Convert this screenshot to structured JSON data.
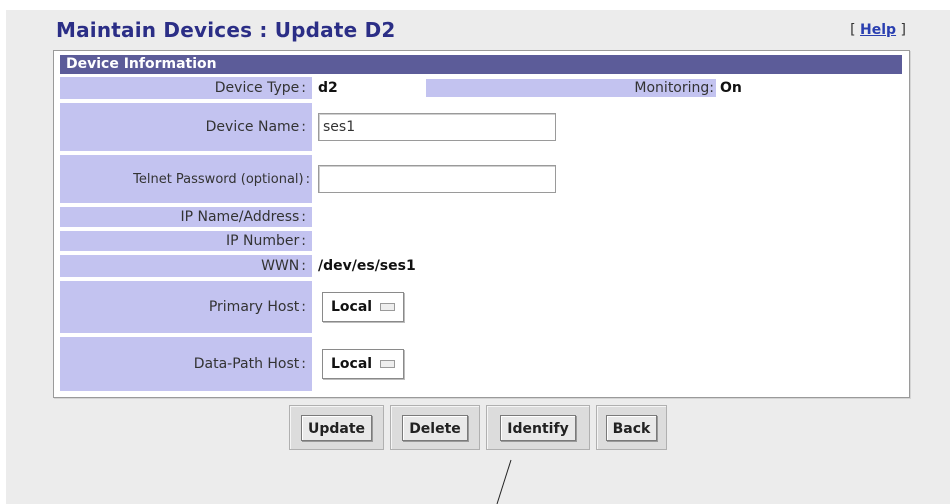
{
  "page": {
    "title": "Maintain Devices : Update D2",
    "help_open": "[ ",
    "help_label": "Help",
    "help_close": " ]"
  },
  "section": {
    "title": "Device Information"
  },
  "fields": {
    "device_type": {
      "label": "Device Type",
      "value": "d2"
    },
    "monitoring": {
      "label": "Monitoring:",
      "value": "On"
    },
    "device_name": {
      "label": "Device Name",
      "value": "ses1",
      "placeholder": ""
    },
    "telnet_password": {
      "label": "Telnet Password (optional)",
      "value": "",
      "placeholder": ""
    },
    "ip_name": {
      "label": "IP Name/Address",
      "value": ""
    },
    "ip_number": {
      "label": "IP Number",
      "value": ""
    },
    "wwn": {
      "label": "WWN",
      "value": "/dev/es/ses1"
    },
    "primary_host": {
      "label": "Primary Host",
      "value": "Local",
      "icon": "dropdown-indicator-icon"
    },
    "data_path_host": {
      "label": "Data-Path Host",
      "value": "Local",
      "icon": "dropdown-indicator-icon"
    }
  },
  "colon": ":",
  "buttons": {
    "update": "Update",
    "delete": "Delete",
    "identify": "Identify",
    "back": "Back"
  },
  "colors": {
    "title": "#2b2e86",
    "section_header_bg": "#5c5c99",
    "label_bg": "#c3c3f0",
    "panel_bg": "#ececec",
    "link": "#2a3fb0"
  }
}
